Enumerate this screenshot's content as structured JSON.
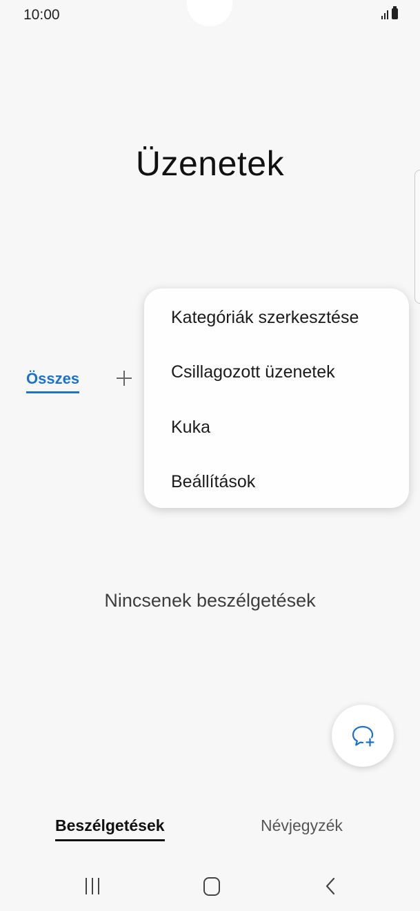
{
  "status_bar": {
    "time": "10:00"
  },
  "header": {
    "title": "Üzenetek"
  },
  "categories": {
    "active_tab": "Összes"
  },
  "popup_menu": {
    "items": [
      {
        "label": "Kategóriák szerkesztése"
      },
      {
        "label": "Csillagozott üzenetek"
      },
      {
        "label": "Kuka"
      },
      {
        "label": "Beállítások"
      }
    ]
  },
  "empty_state": {
    "text": "Nincsenek beszélgetések"
  },
  "fab": {
    "icon": "new-chat-icon",
    "color": "#1a73c8"
  },
  "bottom_tabs": [
    {
      "label": "Beszélgetések",
      "active": true
    },
    {
      "label": "Névjegyzék",
      "active": false
    }
  ],
  "colors": {
    "accent": "#1a73c8",
    "background": "#f7f7f7"
  }
}
